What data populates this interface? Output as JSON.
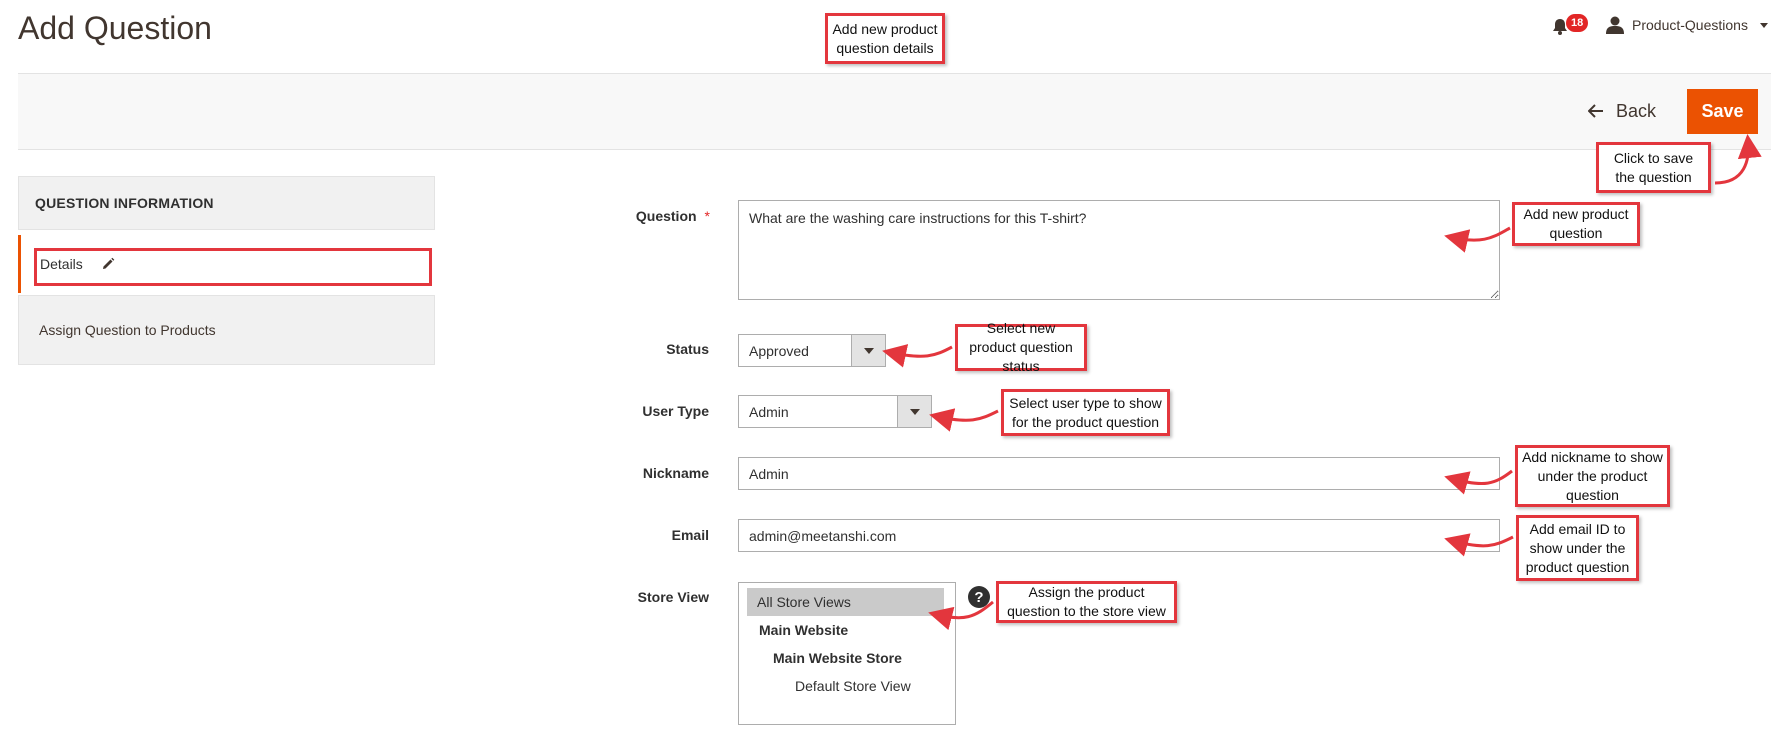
{
  "header": {
    "title": "Add Question",
    "notification_count": "18",
    "user_name": "Product-Questions"
  },
  "toolbar": {
    "back_label": "Back",
    "save_label": "Save"
  },
  "sidebar": {
    "heading": "QUESTION INFORMATION",
    "items": [
      {
        "label": "Details"
      },
      {
        "label": "Assign Question to Products"
      }
    ]
  },
  "form": {
    "question": {
      "label": "Question",
      "value": "What are the washing care instructions for this T-shirt?"
    },
    "status": {
      "label": "Status",
      "value": "Approved"
    },
    "user_type": {
      "label": "User Type",
      "value": "Admin"
    },
    "nickname": {
      "label": "Nickname",
      "value": "Admin"
    },
    "email": {
      "label": "Email",
      "value": "admin@meetanshi.com"
    },
    "store_view": {
      "label": "Store View",
      "options": [
        "All Store Views",
        "Main Website",
        "Main Website Store",
        "Default Store View"
      ]
    }
  },
  "callouts": {
    "details": "Add new product question details",
    "save": "Click to save the question",
    "question": "Add new product question",
    "status": "Select new product question status",
    "user_type": "Select user type to show for the product question",
    "nickname": "Add nickname to show under the product question",
    "email": "Add email ID to show under the product question",
    "store_view": "Assign the product question to the store view"
  },
  "colors": {
    "accent": "#eb5202",
    "annotation": "#e3363d",
    "badge": "#e22626"
  }
}
